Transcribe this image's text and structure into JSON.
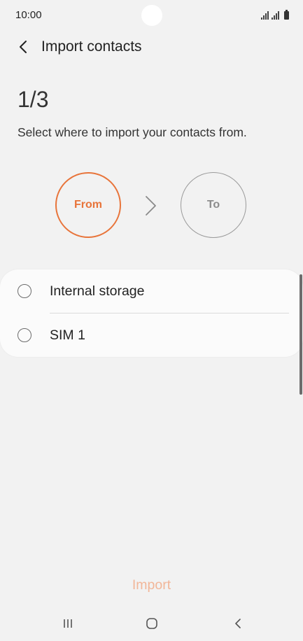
{
  "status_bar": {
    "time": "10:00",
    "icons": [
      "signal-icon",
      "signal-icon",
      "battery-icon"
    ]
  },
  "header": {
    "back_icon": "chevron-left-icon",
    "title": "Import contacts"
  },
  "step": {
    "counter": "1/3",
    "instruction": "Select where to import your contacts from.",
    "from_label": "From",
    "to_label": "To",
    "arrow_icon": "chevron-right-icon"
  },
  "options": [
    {
      "label": "Internal storage",
      "selected": false
    },
    {
      "label": "SIM 1",
      "selected": false
    }
  ],
  "actions": {
    "import_label": "Import"
  },
  "nav": {
    "recent_icon": "recent-apps-icon",
    "home_icon": "home-icon",
    "back_icon": "back-icon"
  },
  "colors": {
    "accent": "#e8743a",
    "accent_disabled": "#f2b698",
    "background": "#f2f2f2",
    "card": "#fbfbfb"
  }
}
